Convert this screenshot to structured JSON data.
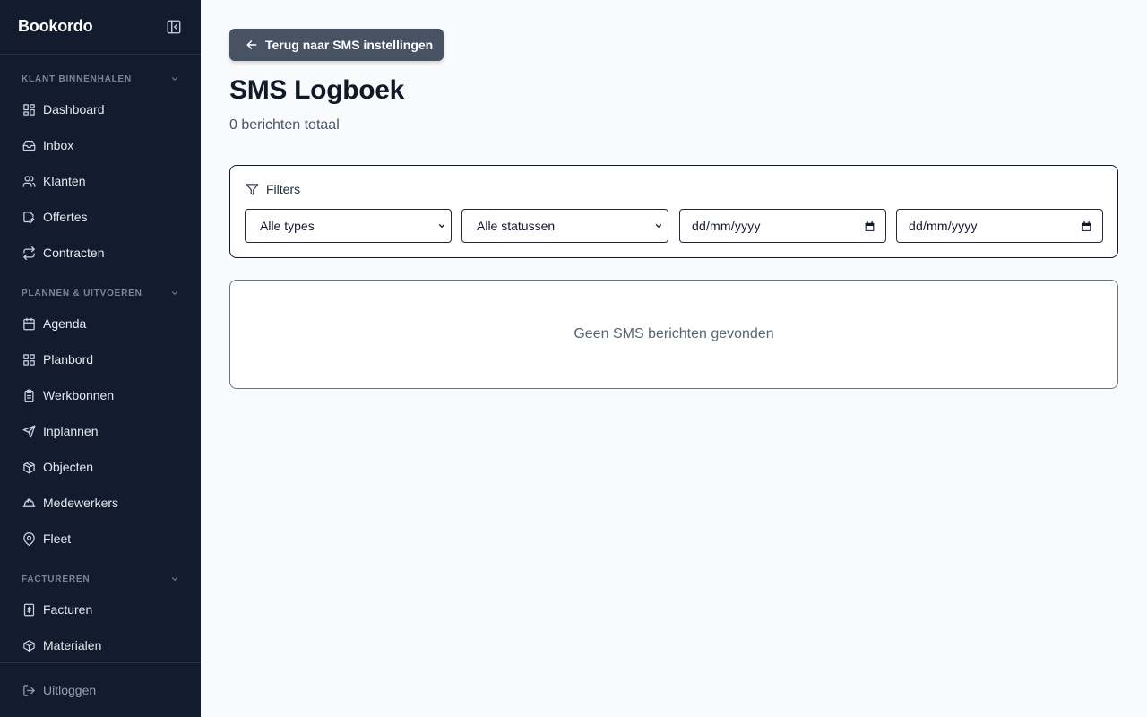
{
  "app": {
    "brand": "Bookordo"
  },
  "sidebar": {
    "sections": [
      {
        "label": "KLANT BINNENHALEN",
        "items": [
          {
            "label": "Dashboard",
            "icon": "dashboard-icon"
          },
          {
            "label": "Inbox",
            "icon": "inbox-icon"
          },
          {
            "label": "Klanten",
            "icon": "users-icon"
          },
          {
            "label": "Offertes",
            "icon": "edit-document-icon"
          },
          {
            "label": "Contracten",
            "icon": "repeat-icon"
          }
        ]
      },
      {
        "label": "PLANNEN & UITVOEREN",
        "items": [
          {
            "label": "Agenda",
            "icon": "calendar-icon"
          },
          {
            "label": "Planbord",
            "icon": "grid-icon"
          },
          {
            "label": "Werkbonnen",
            "icon": "clipboard-icon"
          },
          {
            "label": "Inplannen",
            "icon": "send-icon"
          },
          {
            "label": "Objecten",
            "icon": "boxes-icon"
          },
          {
            "label": "Medewerkers",
            "icon": "hard-hat-icon"
          },
          {
            "label": "Fleet",
            "icon": "map-pin-icon"
          }
        ]
      },
      {
        "label": "FACTUREREN",
        "items": [
          {
            "label": "Facturen",
            "icon": "invoice-dollar-icon"
          },
          {
            "label": "Materialen",
            "icon": "package-icon"
          }
        ]
      }
    ],
    "logout": "Uitloggen"
  },
  "main": {
    "back_button": "Terug naar SMS instellingen",
    "title": "SMS Logboek",
    "subtitle": "0 berichten totaal",
    "filters": {
      "title": "Filters",
      "type_select": "Alle types",
      "status_select": "Alle statussen",
      "date_from": "dd/mm/yyyy",
      "date_to": "dd/mm/yyyy"
    },
    "empty_message": "Geen SMS berichten gevonden"
  },
  "colors": {
    "sidebar_bg": "#131b2e",
    "page_bg": "#f8fafc",
    "button_bg": "#475263",
    "title": "#111827"
  }
}
